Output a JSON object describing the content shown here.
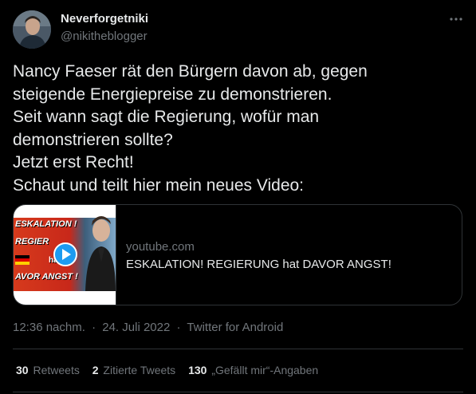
{
  "user": {
    "name": "Neverforgetniki",
    "handle": "@nikitheblogger"
  },
  "tweet": {
    "lines": [
      "Nancy Faeser rät den Bürgern davon ab, gegen",
      "steigende Energiepreise zu demonstrieren.",
      "Seit wann sagt die Regierung, wofür man",
      "demonstrieren sollte?",
      "Jetzt erst Recht!",
      "Schaut und teilt hier mein neues Video:"
    ]
  },
  "card": {
    "domain": "youtube.com",
    "title": "ESKALATION! REGIERUNG hat DAVOR ANGST!",
    "thumbnail": {
      "line1": "ESKALATION !",
      "line2": "REGIER",
      "line3": "hat",
      "line4": "AVOR ANGST !"
    }
  },
  "meta": {
    "time": "12:36 nachm.",
    "separator": "·",
    "date": "24. Juli 2022",
    "source": "Twitter for Android"
  },
  "stats": {
    "retweets_count": "30",
    "retweets_label": "Retweets",
    "quotes_count": "2",
    "quotes_label": "Zitierte Tweets",
    "likes_count": "130",
    "likes_label": "„Gefällt mir“-Angaben"
  },
  "icons": {
    "more": "more-horizontal-icon",
    "play": "play-icon"
  },
  "colors": {
    "background": "#000000",
    "text": "#e7e9ea",
    "muted": "#71767b",
    "border": "#2f3336",
    "play_blue": "#1d9bf0"
  }
}
